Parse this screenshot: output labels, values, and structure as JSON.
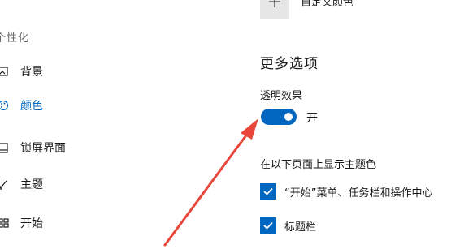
{
  "sidebar": {
    "heading": "个性化",
    "items": [
      {
        "label": "背景",
        "icon": "picture-icon"
      },
      {
        "label": "颜色",
        "icon": "palette-icon",
        "selected": true
      },
      {
        "label": "锁屏界面",
        "icon": "lock-screen-icon"
      },
      {
        "label": "主题",
        "icon": "brush-icon"
      },
      {
        "label": "开始",
        "icon": "start-icon"
      }
    ]
  },
  "main": {
    "add_custom_color_label": "自定义颜色",
    "more_options_title": "更多选项",
    "transparency": {
      "label": "透明效果",
      "state_label": "开",
      "on": true
    },
    "show_accent_label": "在以下页面上显示主题色",
    "checkboxes": [
      {
        "label": "“开始”菜单、任务栏和操作中心",
        "checked": true
      },
      {
        "label": "标题栏",
        "checked": true
      }
    ]
  },
  "colors": {
    "accent": "#0067c0",
    "annotation_arrow": "#e8463a"
  }
}
